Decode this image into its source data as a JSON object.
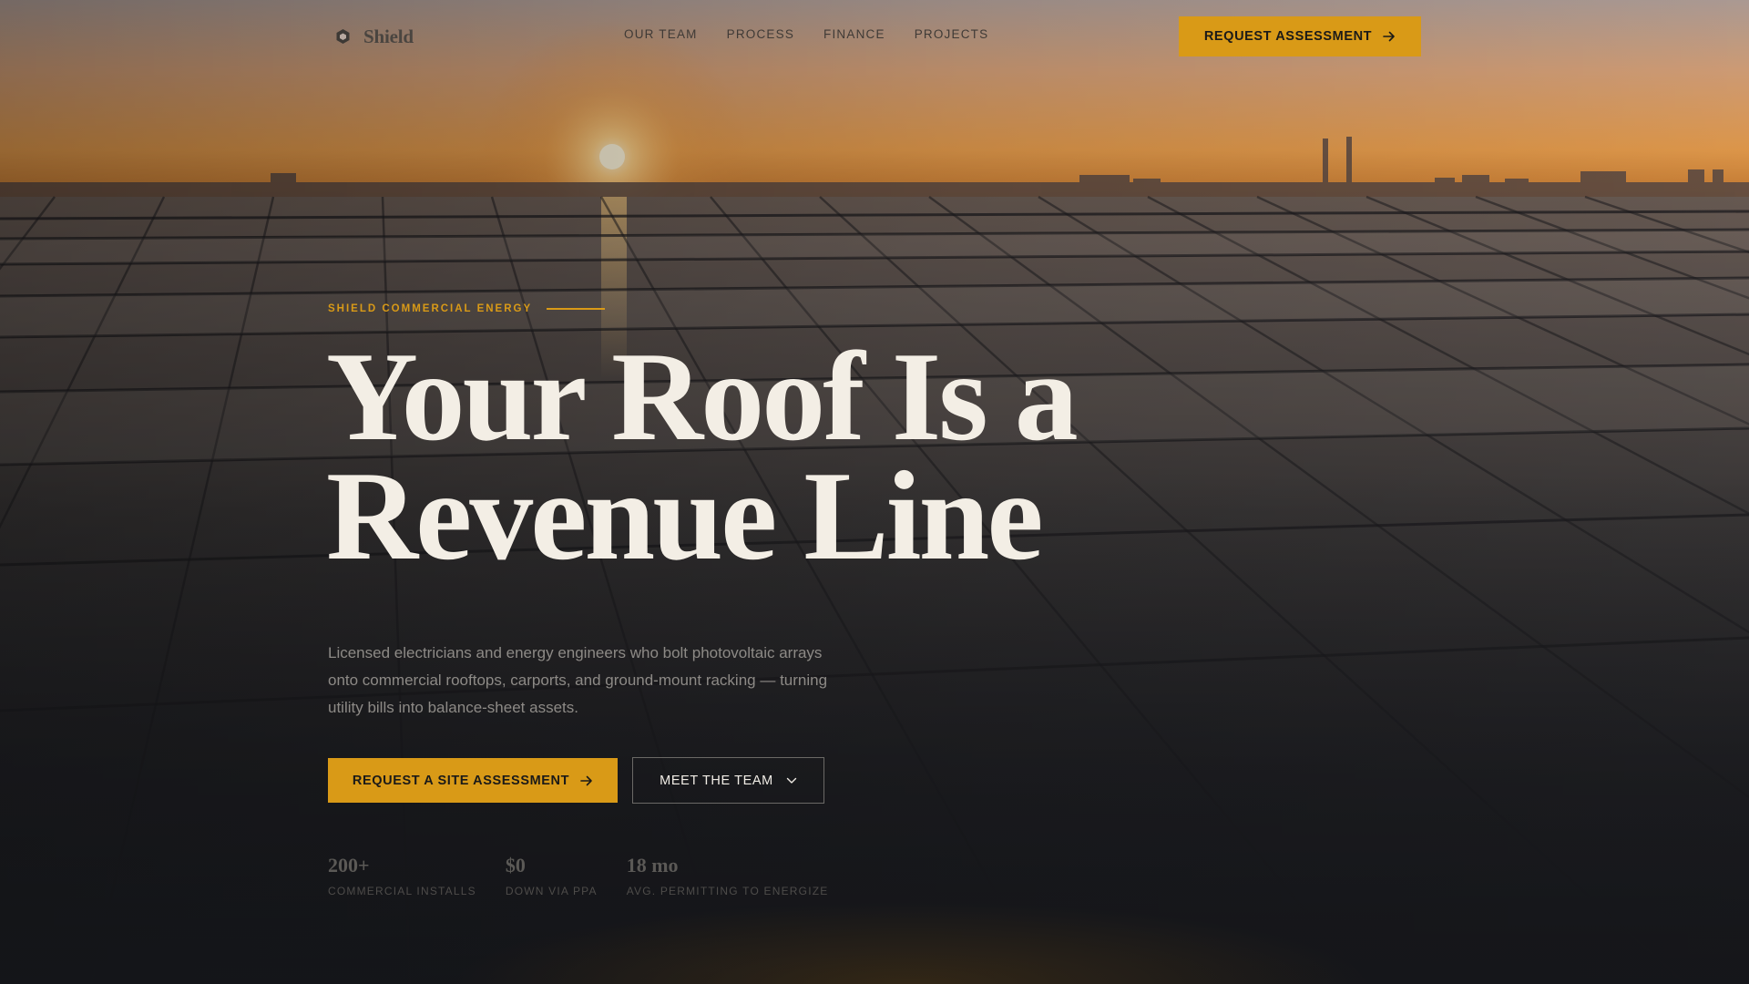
{
  "brand": {
    "name": "Shield",
    "logo_icon": "hexagon-shield-icon"
  },
  "nav": {
    "links": [
      "OUR TEAM",
      "PROCESS",
      "FINANCE",
      "PROJECTS"
    ],
    "cta_label": "REQUEST ASSESSMENT",
    "cta_icon": "arrow-right-icon"
  },
  "hero": {
    "eyebrow": "SHIELD COMMERCIAL ENERGY",
    "headline_line1": "Your Roof Is a",
    "headline_line2": "Revenue Line",
    "lede": "Licensed electricians and energy engineers who bolt photovoltaic arrays onto commercial rooftops, carports, and ground-mount racking — turning utility bills into balance-sheet assets.",
    "primary_cta": "REQUEST A SITE ASSESSMENT",
    "primary_cta_icon": "arrow-right-icon",
    "secondary_cta": "MEET THE TEAM",
    "secondary_cta_icon": "chevron-down-icon"
  },
  "stats": [
    {
      "value": "200+",
      "label": "COMMERCIAL INSTALLS"
    },
    {
      "value": "$0",
      "label": "DOWN VIA PPA"
    },
    {
      "value": "18 mo",
      "label": "AVG. PERMITTING TO ENERGIZE"
    }
  ],
  "colors": {
    "accent": "#d99a17",
    "headline": "#f3eee5",
    "background_dark": "#15161a",
    "sky_warm": "#e0a36b"
  }
}
